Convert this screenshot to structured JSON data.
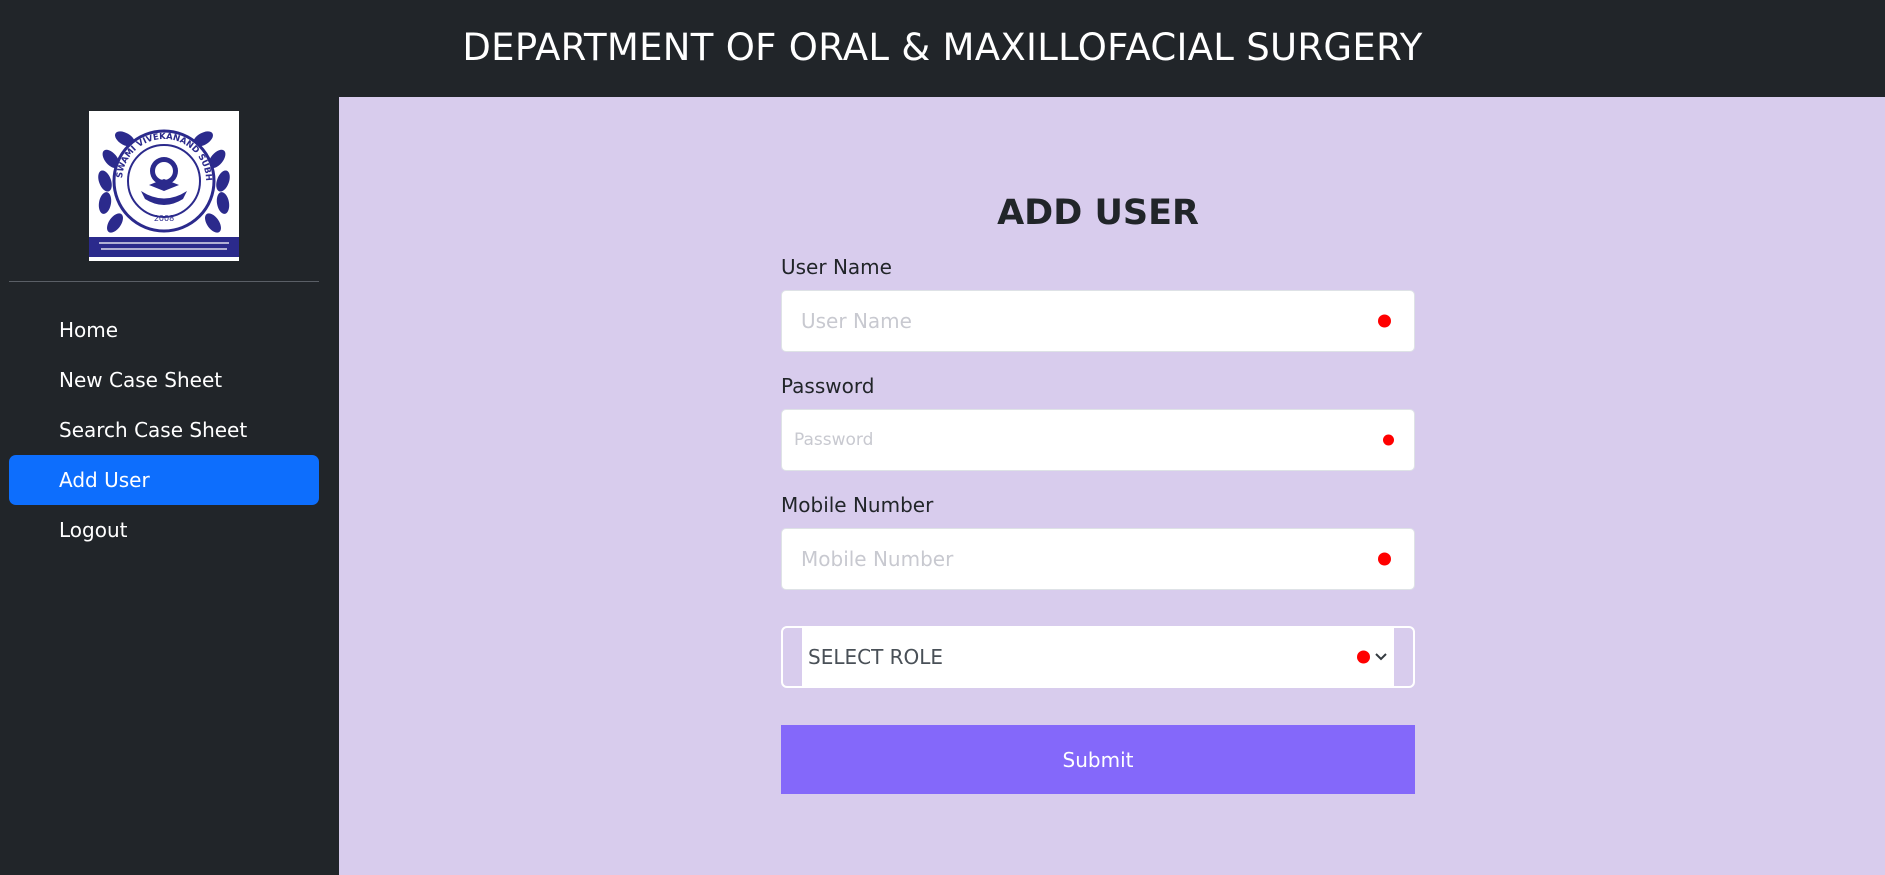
{
  "header": {
    "title": "DEPARTMENT OF ORAL & MAXILLOFACIAL SURGERY"
  },
  "sidebar": {
    "logo": {
      "icon": "university-seal-logo",
      "ring_text": "SWAMI VIVEKANAND SUBHARTI UNIVERSITY",
      "year": "2008"
    },
    "items": [
      {
        "label": "Home",
        "active": false
      },
      {
        "label": "New Case Sheet",
        "active": false
      },
      {
        "label": "Search Case Sheet",
        "active": false
      },
      {
        "label": "Add User",
        "active": true
      },
      {
        "label": "Logout",
        "active": false
      }
    ]
  },
  "form": {
    "title": "ADD USER",
    "username": {
      "label": "User Name",
      "placeholder": "User Name"
    },
    "password": {
      "label": "Password",
      "placeholder": "Password"
    },
    "mobile": {
      "label": "Mobile Number",
      "placeholder": "Mobile Number"
    },
    "role": {
      "value": "SELECT ROLE"
    },
    "submit_label": "Submit"
  },
  "colors": {
    "header_bg": "#212529",
    "main_bg": "#d8cced",
    "active_nav": "#0d6efd",
    "submit_bg": "#8468fa",
    "required_dot": "#ff0000"
  }
}
